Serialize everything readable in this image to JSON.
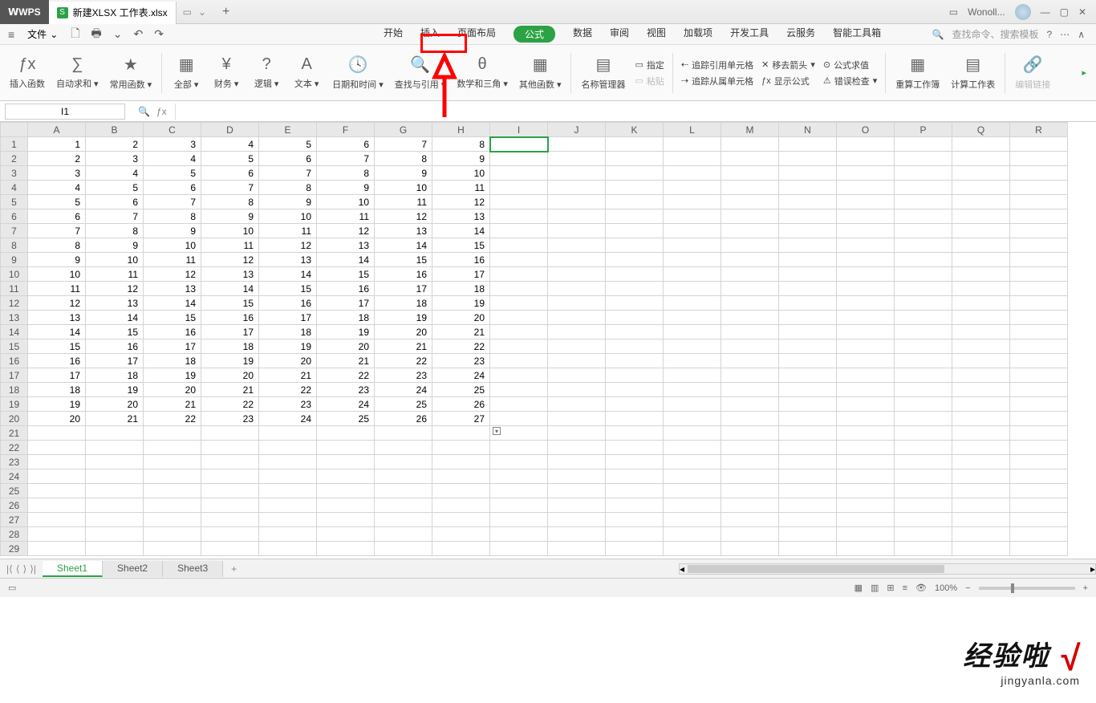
{
  "title": {
    "app": "WPS",
    "doc": "新建XLSX 工作表.xlsx",
    "user": "Wonoll..."
  },
  "menu": {
    "file": "文件"
  },
  "tabs": [
    "开始",
    "插入",
    "页面布局",
    "公式",
    "数据",
    "审阅",
    "视图",
    "加载项",
    "开发工具",
    "云服务",
    "智能工具箱"
  ],
  "active_tab": 3,
  "search_placeholder": "查找命令、搜索模板",
  "ribbon": {
    "b1": "插入函数",
    "b2": "自动求和",
    "b3": "常用函数",
    "b4": "全部",
    "b5": "财务",
    "b6": "逻辑",
    "b7": "文本",
    "b8": "日期和时间",
    "b9": "查找与引用",
    "b10": "数学和三角",
    "b11": "其他函数",
    "b12": "名称管理器",
    "b13": "指定",
    "b14": "粘贴",
    "b15": "追踪引用单元格",
    "b16": "追踪从属单元格",
    "b17": "移去箭头",
    "b18": "显示公式",
    "b19": "公式求值",
    "b20": "错误检查",
    "b21": "重算工作簿",
    "b22": "计算工作表",
    "b23": "编辑链接"
  },
  "namebox": "I1",
  "cols": [
    "A",
    "B",
    "C",
    "D",
    "E",
    "F",
    "G",
    "H",
    "I",
    "J",
    "K",
    "L",
    "M",
    "N",
    "O",
    "P",
    "Q",
    "R"
  ],
  "rows": 29,
  "data_rows": 20,
  "data_cols": 8,
  "sel": {
    "row": 1,
    "col": 9
  },
  "chart_data": {
    "type": "table",
    "columns": [
      "A",
      "B",
      "C",
      "D",
      "E",
      "F",
      "G",
      "H"
    ],
    "rows": [
      [
        1,
        2,
        3,
        4,
        5,
        6,
        7,
        8
      ],
      [
        2,
        3,
        4,
        5,
        6,
        7,
        8,
        9
      ],
      [
        3,
        4,
        5,
        6,
        7,
        8,
        9,
        10
      ],
      [
        4,
        5,
        6,
        7,
        8,
        9,
        10,
        11
      ],
      [
        5,
        6,
        7,
        8,
        9,
        10,
        11,
        12
      ],
      [
        6,
        7,
        8,
        9,
        10,
        11,
        12,
        13
      ],
      [
        7,
        8,
        9,
        10,
        11,
        12,
        13,
        14
      ],
      [
        8,
        9,
        10,
        11,
        12,
        13,
        14,
        15
      ],
      [
        9,
        10,
        11,
        12,
        13,
        14,
        15,
        16
      ],
      [
        10,
        11,
        12,
        13,
        14,
        15,
        16,
        17
      ],
      [
        11,
        12,
        13,
        14,
        15,
        16,
        17,
        18
      ],
      [
        12,
        13,
        14,
        15,
        16,
        17,
        18,
        19
      ],
      [
        13,
        14,
        15,
        16,
        17,
        18,
        19,
        20
      ],
      [
        14,
        15,
        16,
        17,
        18,
        19,
        20,
        21
      ],
      [
        15,
        16,
        17,
        18,
        19,
        20,
        21,
        22
      ],
      [
        16,
        17,
        18,
        19,
        20,
        21,
        22,
        23
      ],
      [
        17,
        18,
        19,
        20,
        21,
        22,
        23,
        24
      ],
      [
        18,
        19,
        20,
        21,
        22,
        23,
        24,
        25
      ],
      [
        19,
        20,
        21,
        22,
        23,
        24,
        25,
        26
      ],
      [
        20,
        21,
        22,
        23,
        24,
        25,
        26,
        27
      ]
    ]
  },
  "sheets": [
    "Sheet1",
    "Sheet2",
    "Sheet3"
  ],
  "active_sheet": 0,
  "zoom": "100%",
  "watermark": {
    "l1": "经验啦",
    "l2": "jingyanla.com"
  }
}
